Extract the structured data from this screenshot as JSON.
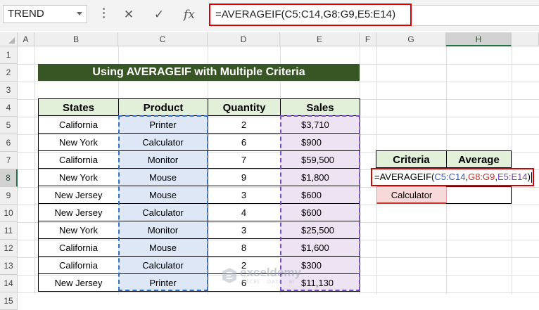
{
  "formula_bar": {
    "name_box": "TREND",
    "cancel_icon": "✕",
    "enter_icon": "✓",
    "fx_label": "fx",
    "formula": "=AVERAGEIF(C5:C14,G8:G9,E5:E14)"
  },
  "columns": [
    "A",
    "B",
    "C",
    "D",
    "E",
    "F",
    "G",
    "H"
  ],
  "rows": [
    "1",
    "2",
    "3",
    "4",
    "5",
    "6",
    "7",
    "8",
    "9",
    "10",
    "11",
    "12",
    "13",
    "14",
    "15"
  ],
  "title": "Using AVERAGEIF with Multiple Criteria",
  "table": {
    "headers": [
      "States",
      "Product",
      "Quantity",
      "Sales"
    ],
    "rows": [
      [
        "California",
        "Printer",
        "2",
        "$3,710"
      ],
      [
        "New York",
        "Calculator",
        "6",
        "$900"
      ],
      [
        "California",
        "Monitor",
        "7",
        "$59,500"
      ],
      [
        "New York",
        "Mouse",
        "9",
        "$1,800"
      ],
      [
        "New Jersey",
        "Mouse",
        "3",
        "$600"
      ],
      [
        "New Jersey",
        "Calculator",
        "4",
        "$600"
      ],
      [
        "New York",
        "Monitor",
        "3",
        "$25,500"
      ],
      [
        "California",
        "Mouse",
        "8",
        "$1,600"
      ],
      [
        "California",
        "Calculator",
        "2",
        "$300"
      ],
      [
        "New Jersey",
        "Printer",
        "6",
        "$11,130"
      ]
    ]
  },
  "criteria_table": {
    "headers": [
      "Criteria",
      "Average"
    ],
    "edit_parts": [
      "=AVERAGEIF(",
      "C5:C14",
      ",",
      "G8:G9",
      ",",
      "E5:E14",
      ")"
    ],
    "criteria_value": "Calculator",
    "average_value": ""
  },
  "watermark": {
    "name": "exceldemy",
    "tagline": "EXCEL · DATA · BI"
  },
  "colors": {
    "title_bg": "#385623",
    "header_bg": "#e2efd9",
    "range_1": "#2f72c4",
    "range_2": "#c4322a",
    "range_3": "#7a3fb0",
    "highlight": "#d60000"
  }
}
